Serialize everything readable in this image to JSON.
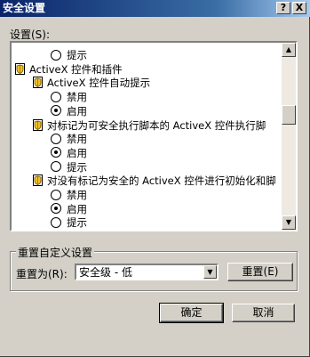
{
  "window": {
    "title": "安全设置",
    "help_label": "?",
    "close_label": "X"
  },
  "settings": {
    "label": "设置(S):",
    "rows": [
      {
        "kind": "radio",
        "text": "提示",
        "selected": false
      },
      {
        "kind": "header",
        "text": "ActiveX 控件和插件"
      },
      {
        "kind": "subheader",
        "text": "ActiveX 控件自动提示"
      },
      {
        "kind": "radio",
        "text": "禁用",
        "selected": false
      },
      {
        "kind": "radio",
        "text": "启用",
        "selected": true
      },
      {
        "kind": "subheader",
        "text": "对标记为可安全执行脚本的 ActiveX 控件执行脚"
      },
      {
        "kind": "radio",
        "text": "禁用",
        "selected": false
      },
      {
        "kind": "radio",
        "text": "启用",
        "selected": true
      },
      {
        "kind": "radio",
        "text": "提示",
        "selected": false
      },
      {
        "kind": "subheader",
        "text": "对没有标记为安全的 ActiveX 控件进行初始化和脚"
      },
      {
        "kind": "radio",
        "text": "禁用",
        "selected": false
      },
      {
        "kind": "radio",
        "text": "启用",
        "selected": true
      },
      {
        "kind": "radio",
        "text": "提示",
        "selected": false
      }
    ]
  },
  "reset": {
    "group_title": "重置自定义设置",
    "label": "重置为(R):",
    "selected_level": "安全级 - 低",
    "button_label": "重置(E)"
  },
  "footer": {
    "ok_label": "确定",
    "cancel_label": "取消"
  }
}
